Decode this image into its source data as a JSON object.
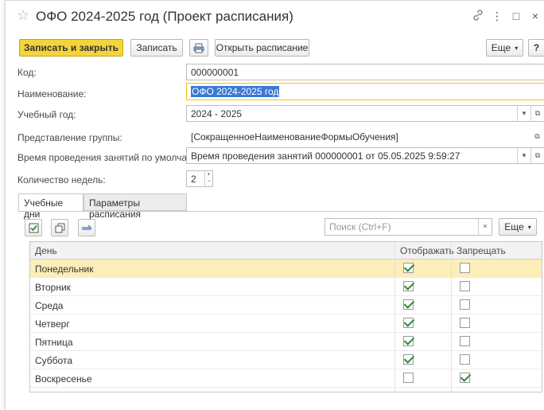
{
  "window": {
    "title": "ОФО 2024-2025 год (Проект расписания)",
    "icons": [
      "link-icon",
      "more-vertical-icon",
      "maximize-icon",
      "close-icon"
    ]
  },
  "toolbar": {
    "save_close": "Записать и закрыть",
    "save": "Записать",
    "open_schedule": "Открыть расписание",
    "more": "Еще",
    "help": "?"
  },
  "form": {
    "code_label": "Код:",
    "code_value": "000000001",
    "name_label": "Наименование:",
    "name_value": "ОФО 2024-2025 год",
    "year_label": "Учебный год:",
    "year_value": "2024 - 2025",
    "group_label": "Представление группы:",
    "group_value": "[СокращенноеНаименованиеФормыОбучения]",
    "time_label": "Время проведения занятий по умолчанию:",
    "time_value": "Время проведения занятий 000000001 от 05.05.2025 9:59:27",
    "weeks_label": "Количество недель:",
    "weeks_value": "2"
  },
  "tabs": {
    "days": "Учебные дни",
    "params": "Параметры расписания"
  },
  "grid_toolbar": {
    "search_placeholder": "Поиск (Ctrl+F)",
    "clear": "×",
    "more": "Еще"
  },
  "table": {
    "columns": [
      "День",
      "Отображать",
      "Запрещать занятия"
    ],
    "rows": [
      {
        "day": "Понедельник",
        "show": true,
        "forbid": false,
        "current": true
      },
      {
        "day": "Вторник",
        "show": true,
        "forbid": false
      },
      {
        "day": "Среда",
        "show": true,
        "forbid": false
      },
      {
        "day": "Четверг",
        "show": true,
        "forbid": false
      },
      {
        "day": "Пятница",
        "show": true,
        "forbid": false
      },
      {
        "day": "Суббота",
        "show": true,
        "forbid": false
      },
      {
        "day": "Воскресенье",
        "show": false,
        "forbid": true
      }
    ]
  },
  "colors": {
    "primary_button": "#f5d33a",
    "current_row": "#fbeeb8",
    "selection": "#3b78d8",
    "checkmark": "#2e8b3a"
  }
}
